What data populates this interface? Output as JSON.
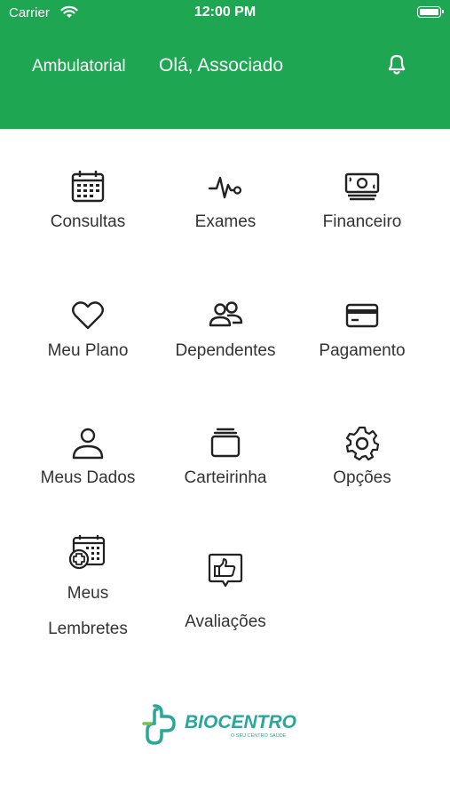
{
  "status_bar": {
    "carrier": "Carrier",
    "time": "12:00 PM"
  },
  "header": {
    "section": "Ambulatorial",
    "greeting": "Olá, Associado",
    "accent": "#1fa653"
  },
  "menu": [
    {
      "label": "Consultas",
      "icon": "calendar-icon"
    },
    {
      "label": "Exames",
      "icon": "heartbeat-icon"
    },
    {
      "label": "Financeiro",
      "icon": "money-icon"
    },
    {
      "label": "Meu Plano",
      "icon": "heart-icon"
    },
    {
      "label": "Dependentes",
      "icon": "users-icon"
    },
    {
      "label": "Pagamento",
      "icon": "card-icon"
    },
    {
      "label": "Meus Dados",
      "icon": "user-icon"
    },
    {
      "label": "Carteirinha",
      "icon": "cards-stack-icon"
    },
    {
      "label": "Opções",
      "icon": "gear-icon"
    },
    {
      "label_line1": "Meus",
      "label_line2": "Lembretes",
      "icon": "calendar-plus-icon"
    },
    {
      "label": "Avaliações",
      "icon": "thumbs-up-icon"
    }
  ],
  "logo": {
    "brand": "BIOCENTRO",
    "tagline": "O SEU CENTRO SAÚDE"
  }
}
